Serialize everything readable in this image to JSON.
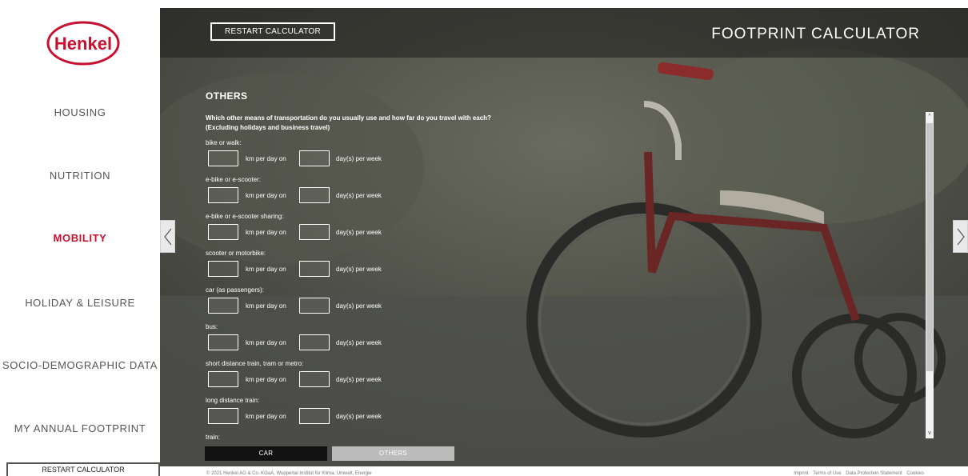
{
  "brand": {
    "logo_text": "Henkel",
    "accent": "#c8102e"
  },
  "sidebar": {
    "items": [
      {
        "label": "HOUSING",
        "active": false
      },
      {
        "label": "NUTRITION",
        "active": false
      },
      {
        "label": "MOBILITY",
        "active": true
      },
      {
        "label": "HOLIDAY & LEISURE",
        "active": false
      },
      {
        "label": "SOCIO-DEMOGRAPHIC DATA",
        "active": false
      },
      {
        "label": "MY ANNUAL FOOTPRINT",
        "active": false
      }
    ],
    "restart_label": "RESTART CALCULATOR"
  },
  "header": {
    "restart_label": "RESTART CALCULATOR",
    "title": "FOOTPRINT CALCULATOR"
  },
  "form": {
    "section_title": "OTHERS",
    "question_line1": "Which other means of transportation do you usually use and how far do you travel with each?",
    "question_line2": "(Excluding holidays and business travel)",
    "km_text": "km per day on",
    "days_text": "day(s) per week",
    "rows": [
      {
        "label": "bike or walk:"
      },
      {
        "label": "e-bike or e-scooter:"
      },
      {
        "label": "e-bike or e-scooter sharing:"
      },
      {
        "label": "scooter or motorbike:"
      },
      {
        "label": "car (as passengers):"
      },
      {
        "label": "bus:"
      },
      {
        "label": "short distance train, tram or metro:"
      },
      {
        "label": "long distance train:"
      },
      {
        "label": "train:"
      }
    ]
  },
  "scrollbar": {
    "up_glyph": "^",
    "down_glyph": "v"
  },
  "tabs": [
    {
      "label": "CAR",
      "active": true
    },
    {
      "label": "OTHERS",
      "active": false
    }
  ],
  "footer": {
    "copyright": "© 2021 Henkel AG & Co. KGaA, Wuppertal Institut für Klima, Umwelt, Energie",
    "links": [
      "Imprint",
      "Terms of Use",
      "Data Protection Statement",
      "Cookies"
    ]
  }
}
